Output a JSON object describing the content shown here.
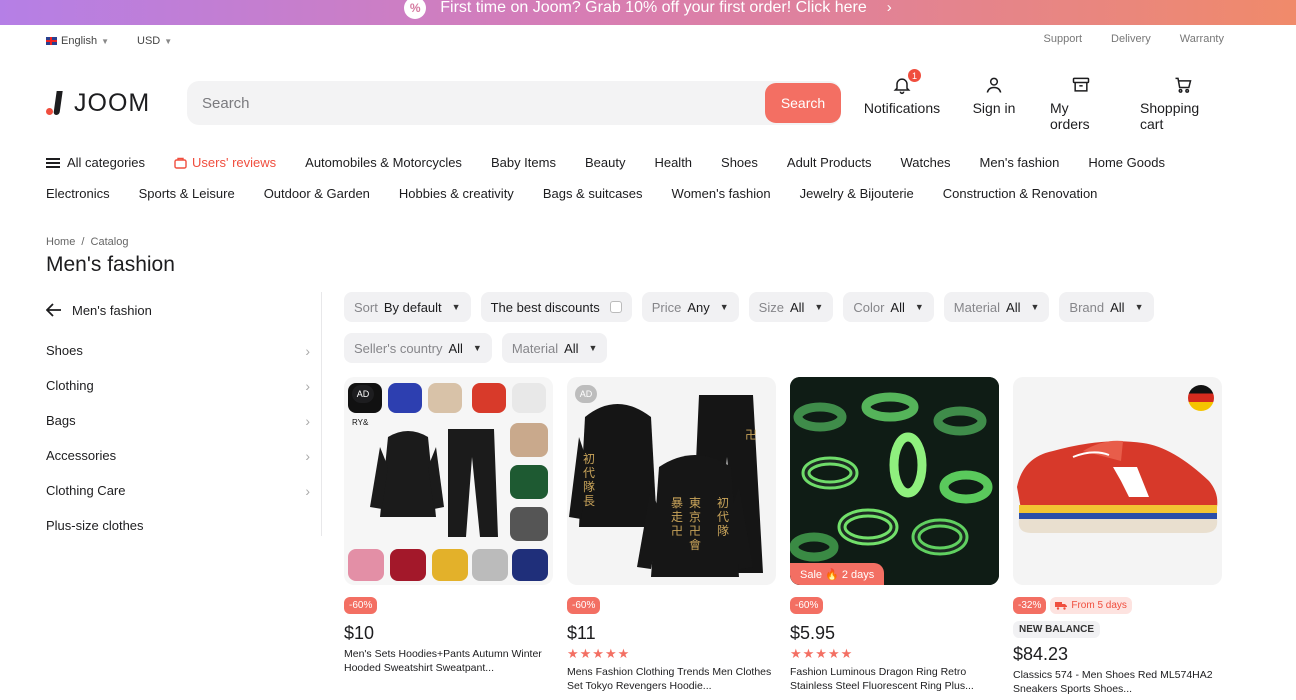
{
  "promo": {
    "text": "First time on Joom? Grab 10% off your first order! Click here",
    "arrow": "›"
  },
  "topbar": {
    "language": "English",
    "currency": "USD",
    "links": [
      "Support",
      "Delivery",
      "Warranty"
    ]
  },
  "header": {
    "logo_text": "JOOM",
    "search_placeholder": "Search",
    "search_button": "Search",
    "notifications_label": "Notifications",
    "notifications_count": "1",
    "signin_label": "Sign in",
    "orders_label": "My orders",
    "cart_label": "Shopping cart"
  },
  "categories": {
    "all": "All categories",
    "reviews": "Users' reviews",
    "row1": [
      "Automobiles & Motorcycles",
      "Baby Items",
      "Beauty",
      "Health",
      "Shoes",
      "Adult Products",
      "Watches",
      "Men's fashion",
      "Home Goods"
    ],
    "row2": [
      "Electronics",
      "Sports & Leisure",
      "Outdoor & Garden",
      "Hobbies & creativity",
      "Bags & suitcases",
      "Women's fashion",
      "Jewelry & Bijouterie",
      "Construction & Renovation"
    ]
  },
  "breadcrumb": {
    "home": "Home",
    "sep": "/",
    "catalog": "Catalog"
  },
  "page_title": "Men's fashion",
  "sidebar": {
    "back_label": "Men's fashion",
    "items": [
      {
        "label": "Shoes",
        "chevron": "›"
      },
      {
        "label": "Clothing",
        "chevron": "›"
      },
      {
        "label": "Bags",
        "chevron": "›"
      },
      {
        "label": "Accessories",
        "chevron": "›"
      },
      {
        "label": "Clothing Care",
        "chevron": "›"
      },
      {
        "label": "Plus-size clothes",
        "chevron": ""
      }
    ]
  },
  "filters": {
    "sort": {
      "key": "Sort",
      "value": "By default"
    },
    "discounts": "The best discounts",
    "price": {
      "key": "Price",
      "value": "Any"
    },
    "size": {
      "key": "Size",
      "value": "All"
    },
    "color": {
      "key": "Color",
      "value": "All"
    },
    "material": {
      "key": "Material",
      "value": "All"
    },
    "brand": {
      "key": "Brand",
      "value": "All"
    },
    "seller_country": {
      "key": "Seller's country",
      "value": "All"
    },
    "material2": {
      "key": "Material",
      "value": "All"
    }
  },
  "products": [
    {
      "ad": "AD",
      "discount": "-60%",
      "price": "$10",
      "title": "Men's Sets Hoodies+Pants Autumn Winter Hooded Sweatshirt Sweatpant..."
    },
    {
      "ad": "AD",
      "discount": "-60%",
      "price": "$11",
      "rating": 4.5,
      "stars": "★★★★★",
      "title": "Mens Fashion Clothing Trends Men Clothes Set Tokyo Revengers Hoodie..."
    },
    {
      "sale": "Sale 🔥 2 days",
      "discount": "-60%",
      "price": "$5.95",
      "rating": 4.5,
      "stars": "★★★★★",
      "title": "Fashion Luminous Dragon Ring Retro Stainless Steel Fluorescent Ring Plus..."
    },
    {
      "discount": "-32%",
      "shipping": "From 5 days",
      "brand": "NEW BALANCE",
      "price": "$84.23",
      "title": "Classics 574 - Men Shoes Red ML574HA2 Sneakers Sports Shoes..."
    }
  ],
  "colors": {
    "accent": "#f36f63",
    "text": "#1d1d1f",
    "chip_bg": "#f1f1f3"
  }
}
